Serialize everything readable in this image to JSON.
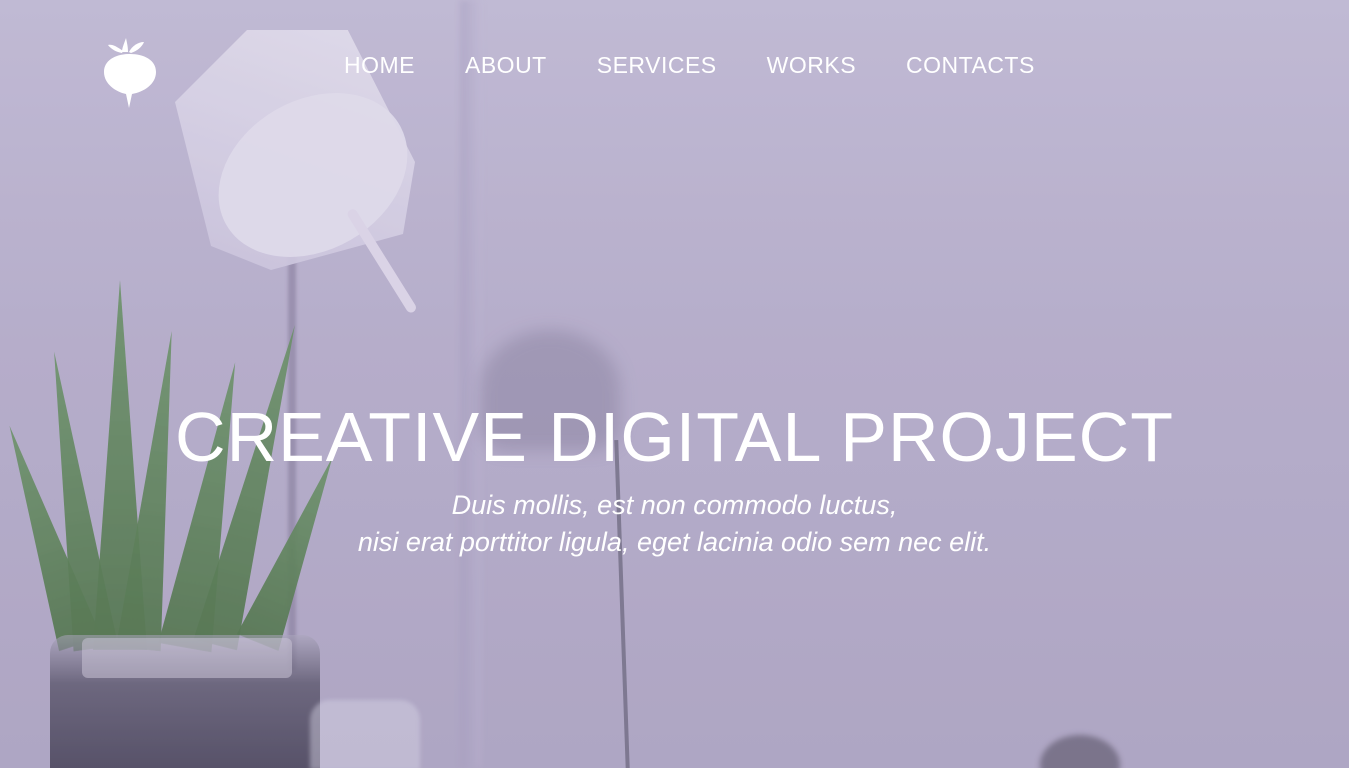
{
  "header": {
    "logo_icon": "radish-logo-icon"
  },
  "nav": {
    "items": [
      {
        "label": "HOME"
      },
      {
        "label": "ABOUT"
      },
      {
        "label": "SERVICES"
      },
      {
        "label": "WORKS"
      },
      {
        "label": "CONTACTS"
      }
    ]
  },
  "hero": {
    "title": "CREATIVE DIGITAL PROJECT",
    "subtitle_line1": "Duis mollis, est non commodo luctus,",
    "subtitle_line2": "nisi erat porttitor ligula, eget lacinia odio sem nec elit."
  },
  "colors": {
    "text": "#ffffff",
    "background_tint": "#b6aecb"
  }
}
